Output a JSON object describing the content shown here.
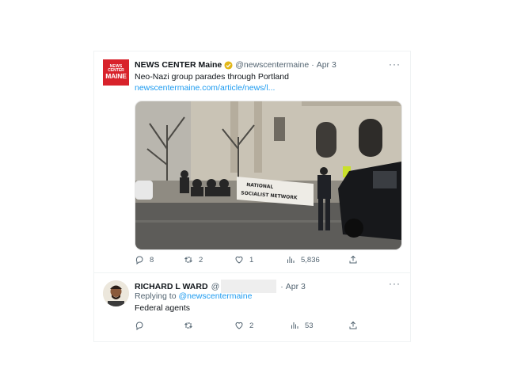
{
  "tweets": [
    {
      "display_name": "NEWS CENTER Maine",
      "handle": "@newscentermaine",
      "separator": "·",
      "date": "Apr 3",
      "more_label": "···",
      "text": "Neo-Nazi group parades through Portland",
      "link": "newscentermaine.com/article/news/l...",
      "avatar_text": [
        "NEWS",
        "CENTER",
        "MAINE"
      ],
      "media_banner_text": [
        "NATIONAL",
        "SOCIALIST NETWORK"
      ],
      "replies": "8",
      "retweets": "2",
      "likes": "1",
      "views": "5,836"
    },
    {
      "display_name": "RICHARD L WARD",
      "handle": "@",
      "separator": "·",
      "date": "Apr 3",
      "more_label": "···",
      "replying_prefix": "Replying to",
      "replying_handle": "@newscentermaine",
      "text": "Federal agents",
      "replies": "",
      "retweets": "",
      "likes": "2",
      "views": "53"
    }
  ],
  "colors": {
    "link": "#1d9bf0",
    "muted": "#536471",
    "brand": "#d8222b",
    "verified": "#e2b719"
  },
  "icons": [
    "reply-icon",
    "retweet-icon",
    "like-icon",
    "views-icon",
    "share-icon",
    "verified-badge-icon",
    "more-icon"
  ]
}
